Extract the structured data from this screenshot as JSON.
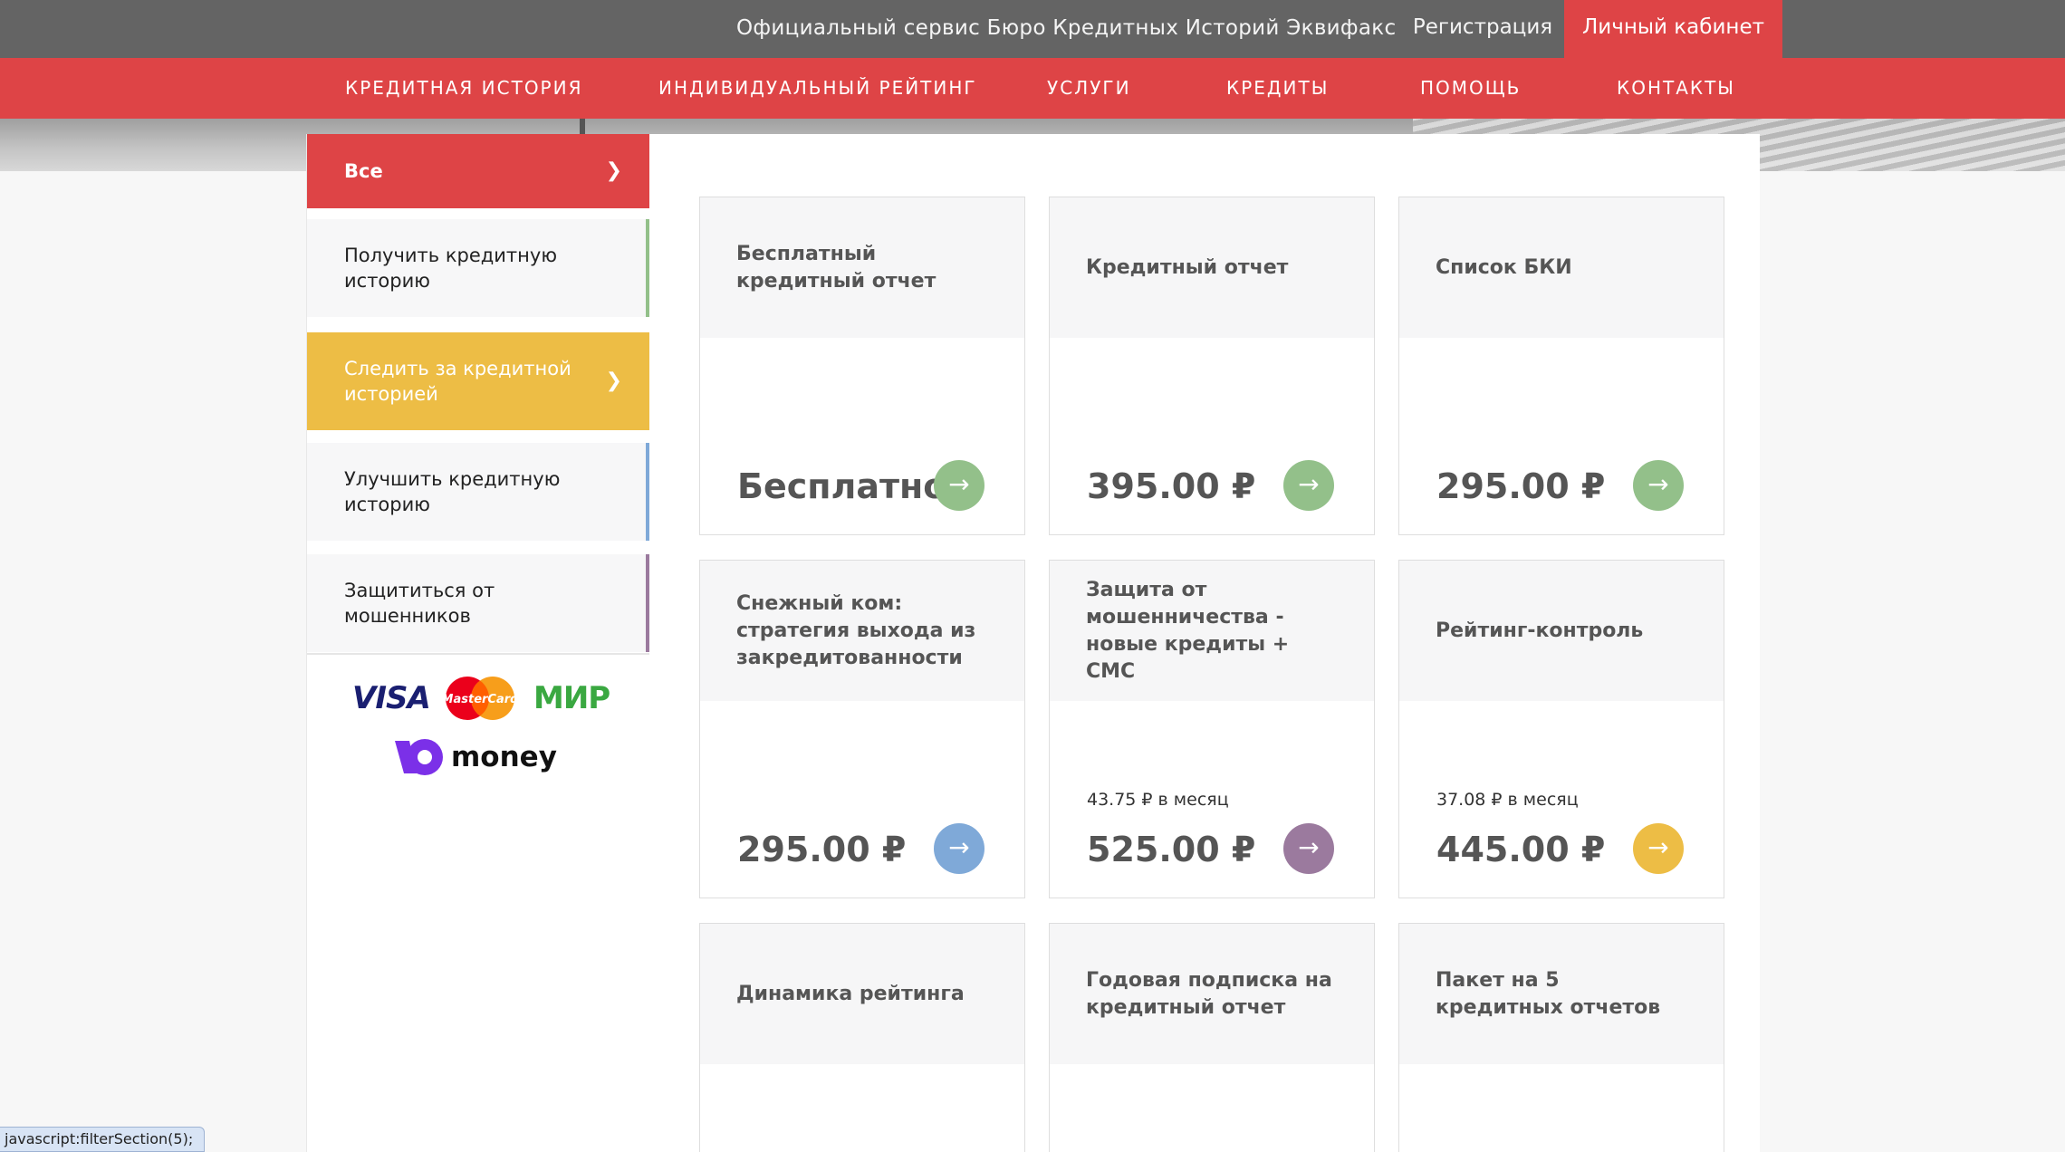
{
  "topbar": {
    "brand": "Официальный сервис Бюро Кредитных Историй Эквифакс",
    "register": "Регистрация",
    "cabinet": "Личный кабинет"
  },
  "nav": {
    "items": [
      "КРЕДИТНАЯ ИСТОРИЯ",
      "ИНДИВИДУАЛЬНЫЙ РЕЙТИНГ",
      "УСЛУГИ",
      "КРЕДИТЫ",
      "ПОМОЩЬ",
      "КОНТАКТЫ"
    ]
  },
  "sidebar": {
    "chevron": "❯",
    "items": [
      {
        "label": "Все"
      },
      {
        "label": "Получить кредитную историю",
        "accent": "#93c08a"
      },
      {
        "label": "Следить за кредитной историей"
      },
      {
        "label": "Улучшить кредитную историю",
        "accent": "#7fa9d8"
      },
      {
        "label": "Защититься от мошенников",
        "accent": "#9b7a9e"
      }
    ],
    "payment": {
      "visa": "VISA",
      "mastercard": "MasterCard",
      "mir": "МИР",
      "yoomoney": "money"
    }
  },
  "cards": [
    {
      "title": "Бесплатный кредитный отчет",
      "price": "Бесплатно",
      "per_month": "",
      "button_color": "#93c08a",
      "arrow": "→"
    },
    {
      "title": "Кредитный отчет",
      "price": "395.00 ₽",
      "per_month": "",
      "button_color": "#93c08a",
      "arrow": "→"
    },
    {
      "title": "Список БКИ",
      "price": "295.00 ₽",
      "per_month": "",
      "button_color": "#93c08a",
      "arrow": "→"
    },
    {
      "title": "Снежный ком: стратегия выхода из закредитованности",
      "price": "295.00 ₽",
      "per_month": "",
      "button_color": "#7fa9d8",
      "arrow": "→"
    },
    {
      "title": "Защита от мошенничества - новые кредиты + СМС",
      "price": "525.00 ₽",
      "per_month": "43.75 ₽ в месяц",
      "button_color": "#9b7a9e",
      "arrow": "→"
    },
    {
      "title": "Рейтинг-контроль",
      "price": "445.00 ₽",
      "per_month": "37.08 ₽ в месяц",
      "button_color": "#edbd45",
      "arrow": "→"
    },
    {
      "title": "Динамика рейтинга"
    },
    {
      "title": "Годовая подписка на кредитный отчет"
    },
    {
      "title": "Пакет на 5 кредитных отчетов"
    }
  ],
  "status_url": "javascript:filterSection(5);"
}
